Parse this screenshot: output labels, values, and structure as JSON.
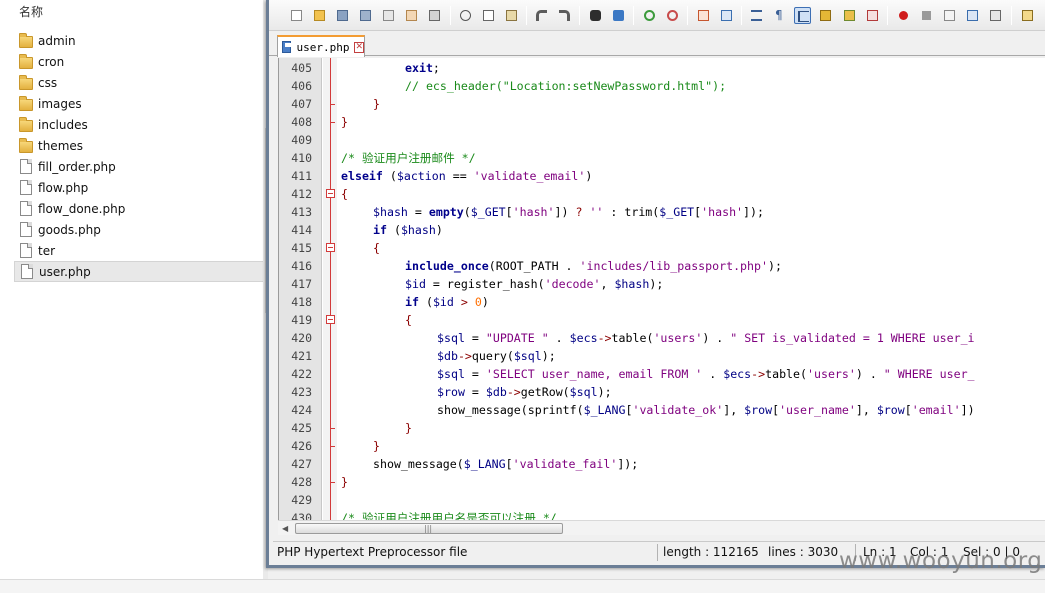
{
  "explorer": {
    "column_header": "名称",
    "items": [
      {
        "name": "admin",
        "type": "folder"
      },
      {
        "name": "cron",
        "type": "folder"
      },
      {
        "name": "css",
        "type": "folder"
      },
      {
        "name": "images",
        "type": "folder"
      },
      {
        "name": "includes",
        "type": "folder"
      },
      {
        "name": "themes",
        "type": "folder"
      },
      {
        "name": "fill_order.php",
        "type": "file"
      },
      {
        "name": "flow.php",
        "type": "file"
      },
      {
        "name": "flow_done.php",
        "type": "file"
      },
      {
        "name": "goods.php",
        "type": "file"
      },
      {
        "name": "ter",
        "type": "file"
      },
      {
        "name": "user.php",
        "type": "file",
        "selected": true
      }
    ]
  },
  "editor": {
    "tab_label": "user.php",
    "fold_color": "#d23b3b",
    "lines": [
      {
        "n": "405",
        "indent": 2,
        "tokens": [
          [
            "kw",
            "exit"
          ],
          [
            "plain",
            ";"
          ]
        ]
      },
      {
        "n": "406",
        "indent": 2,
        "tokens": [
          [
            "cm",
            "// ecs_header(\"Location:setNewPassword.html\");"
          ]
        ]
      },
      {
        "n": "407",
        "indent": 1,
        "tokens": [
          [
            "op",
            "}"
          ]
        ]
      },
      {
        "n": "408",
        "indent": 0,
        "tokens": [
          [
            "op",
            "}"
          ]
        ]
      },
      {
        "n": "409",
        "indent": 0,
        "tokens": []
      },
      {
        "n": "410",
        "indent": 0,
        "tokens": [
          [
            "cm",
            "/* 验证用户注册邮件 */"
          ]
        ]
      },
      {
        "n": "411",
        "indent": 0,
        "tokens": [
          [
            "kw",
            "elseif"
          ],
          [
            "plain",
            " ("
          ],
          [
            "var",
            "$action"
          ],
          [
            "plain",
            " == "
          ],
          [
            "str",
            "'validate_email'"
          ],
          [
            "plain",
            ")"
          ]
        ]
      },
      {
        "n": "412",
        "indent": 0,
        "tokens": [
          [
            "op",
            "{"
          ]
        ]
      },
      {
        "n": "413",
        "indent": 1,
        "tokens": [
          [
            "var",
            "$hash"
          ],
          [
            "plain",
            " = "
          ],
          [
            "kw",
            "empty"
          ],
          [
            "plain",
            "("
          ],
          [
            "var",
            "$_GET"
          ],
          [
            "plain",
            "["
          ],
          [
            "str",
            "'hash'"
          ],
          [
            "plain",
            "]) "
          ],
          [
            "op",
            "?"
          ],
          [
            "plain",
            " "
          ],
          [
            "str",
            "''"
          ],
          [
            "plain",
            " : trim("
          ],
          [
            "var",
            "$_GET"
          ],
          [
            "plain",
            "["
          ],
          [
            "str",
            "'hash'"
          ],
          [
            "plain",
            "]);"
          ]
        ]
      },
      {
        "n": "414",
        "indent": 1,
        "tokens": [
          [
            "kw",
            "if"
          ],
          [
            "plain",
            " ("
          ],
          [
            "var",
            "$hash"
          ],
          [
            "plain",
            ")"
          ]
        ]
      },
      {
        "n": "415",
        "indent": 1,
        "tokens": [
          [
            "op",
            "{"
          ]
        ]
      },
      {
        "n": "416",
        "indent": 2,
        "tokens": [
          [
            "kw",
            "include_once"
          ],
          [
            "plain",
            "(ROOT_PATH . "
          ],
          [
            "str",
            "'includes/lib_passport.php'"
          ],
          [
            "plain",
            ");"
          ]
        ]
      },
      {
        "n": "417",
        "indent": 2,
        "tokens": [
          [
            "var",
            "$id"
          ],
          [
            "plain",
            " = register_hash("
          ],
          [
            "str",
            "'decode'"
          ],
          [
            "plain",
            ", "
          ],
          [
            "var",
            "$hash"
          ],
          [
            "plain",
            ");"
          ]
        ]
      },
      {
        "n": "418",
        "indent": 2,
        "tokens": [
          [
            "kw",
            "if"
          ],
          [
            "plain",
            " ("
          ],
          [
            "var",
            "$id"
          ],
          [
            "plain",
            " "
          ],
          [
            "op",
            ">"
          ],
          [
            "plain",
            " "
          ],
          [
            "num",
            "0"
          ],
          [
            "plain",
            ")"
          ]
        ]
      },
      {
        "n": "419",
        "indent": 2,
        "tokens": [
          [
            "op",
            "{"
          ]
        ]
      },
      {
        "n": "420",
        "indent": 3,
        "tokens": [
          [
            "var",
            "$sql"
          ],
          [
            "plain",
            " = "
          ],
          [
            "str",
            "\"UPDATE \""
          ],
          [
            "plain",
            " . "
          ],
          [
            "var",
            "$ecs"
          ],
          [
            "op",
            "->"
          ],
          [
            "plain",
            "table("
          ],
          [
            "str",
            "'users'"
          ],
          [
            "plain",
            ") . "
          ],
          [
            "str",
            "\" SET is_validated = 1 WHERE user_i"
          ]
        ]
      },
      {
        "n": "421",
        "indent": 3,
        "tokens": [
          [
            "var",
            "$db"
          ],
          [
            "op",
            "->"
          ],
          [
            "plain",
            "query("
          ],
          [
            "var",
            "$sql"
          ],
          [
            "plain",
            ");"
          ]
        ]
      },
      {
        "n": "422",
        "indent": 3,
        "tokens": [
          [
            "var",
            "$sql"
          ],
          [
            "plain",
            " = "
          ],
          [
            "str",
            "'SELECT user_name, email FROM '"
          ],
          [
            "plain",
            " . "
          ],
          [
            "var",
            "$ecs"
          ],
          [
            "op",
            "->"
          ],
          [
            "plain",
            "table("
          ],
          [
            "str",
            "'users'"
          ],
          [
            "plain",
            ") . "
          ],
          [
            "str",
            "\" WHERE user_"
          ]
        ]
      },
      {
        "n": "423",
        "indent": 3,
        "tokens": [
          [
            "var",
            "$row"
          ],
          [
            "plain",
            " = "
          ],
          [
            "var",
            "$db"
          ],
          [
            "op",
            "->"
          ],
          [
            "plain",
            "getRow("
          ],
          [
            "var",
            "$sql"
          ],
          [
            "plain",
            ");"
          ]
        ]
      },
      {
        "n": "424",
        "indent": 3,
        "tokens": [
          [
            "plain",
            "show_message(sprintf("
          ],
          [
            "var",
            "$_LANG"
          ],
          [
            "plain",
            "["
          ],
          [
            "str",
            "'validate_ok'"
          ],
          [
            "plain",
            "], "
          ],
          [
            "var",
            "$row"
          ],
          [
            "plain",
            "["
          ],
          [
            "str",
            "'user_name'"
          ],
          [
            "plain",
            "], "
          ],
          [
            "var",
            "$row"
          ],
          [
            "plain",
            "["
          ],
          [
            "str",
            "'email'"
          ],
          [
            "plain",
            "])"
          ]
        ]
      },
      {
        "n": "425",
        "indent": 2,
        "tokens": [
          [
            "op",
            "}"
          ]
        ]
      },
      {
        "n": "426",
        "indent": 1,
        "tokens": [
          [
            "op",
            "}"
          ]
        ]
      },
      {
        "n": "427",
        "indent": 1,
        "tokens": [
          [
            "plain",
            "show_message("
          ],
          [
            "var",
            "$_LANG"
          ],
          [
            "plain",
            "["
          ],
          [
            "str",
            "'validate_fail'"
          ],
          [
            "plain",
            "]);"
          ]
        ]
      },
      {
        "n": "428",
        "indent": 0,
        "tokens": [
          [
            "op",
            "}"
          ]
        ]
      },
      {
        "n": "429",
        "indent": 0,
        "tokens": []
      },
      {
        "n": "430",
        "indent": 0,
        "tokens": [
          [
            "cm",
            "/* 验证用户注册用户名是否可以注册 */"
          ]
        ]
      }
    ]
  },
  "statusbar": {
    "file_type": "PHP Hypertext Preprocessor file",
    "length": "length : 112165",
    "lines": "lines : 3030",
    "ln": "Ln : 1",
    "col": "Col : 1",
    "sel": "Sel : 0 | 0"
  },
  "watermark": "www.wooyun.org"
}
